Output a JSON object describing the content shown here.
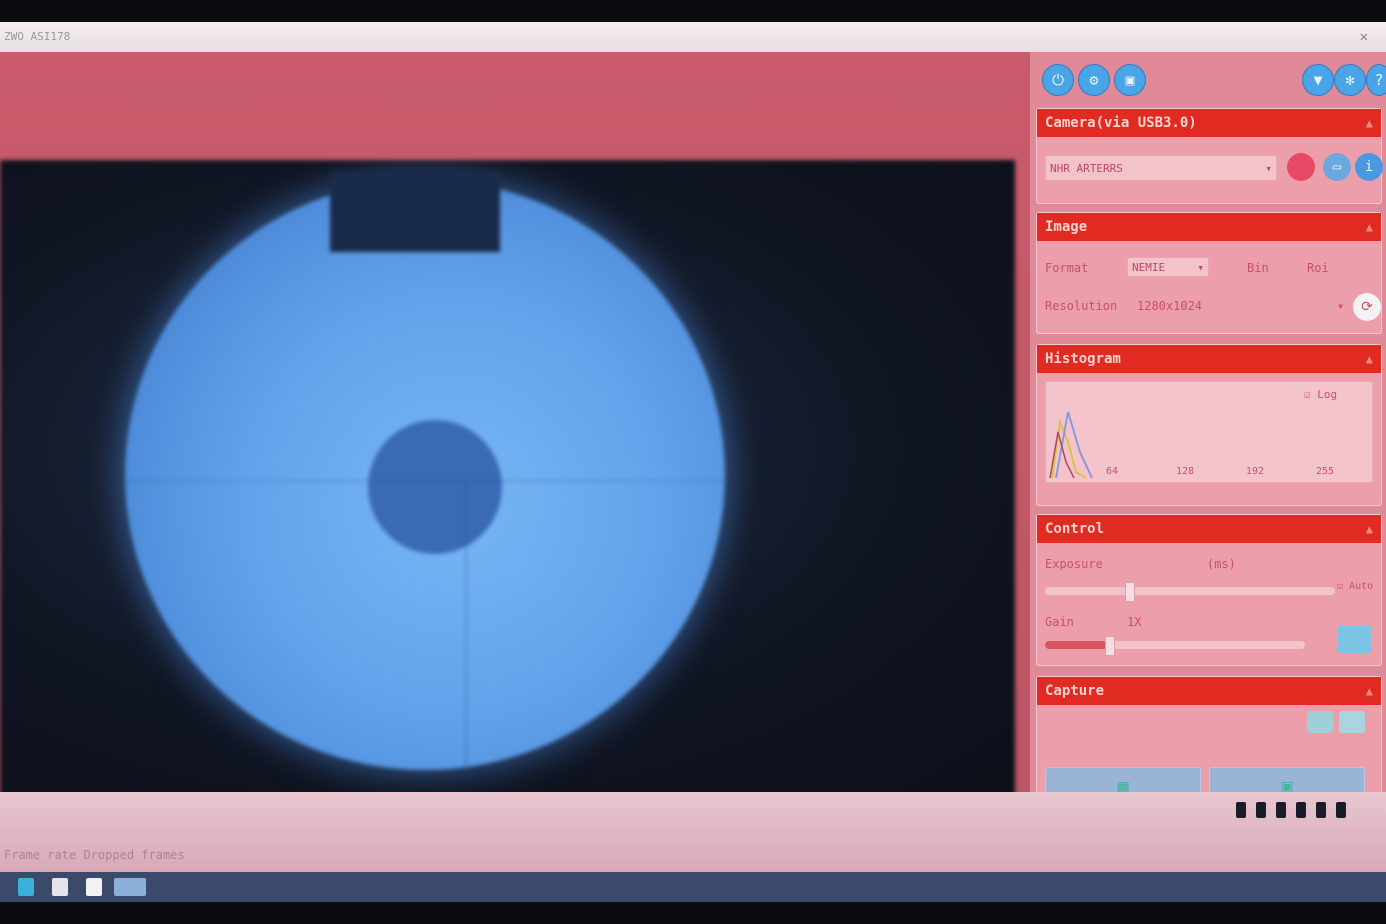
{
  "colors": {
    "section_header": "#e02a22",
    "panel_bg": "#e08a98",
    "beam": "#62a2ea",
    "toolbar_icon": "#4aa4e8"
  },
  "toolbar": {
    "left_icons": [
      "usb-icon",
      "settings-circle-icon",
      "save-icon"
    ],
    "right_icons": [
      "shirt-icon",
      "gear-icon",
      "help-icon"
    ]
  },
  "camera": {
    "header": "Camera(via USB3.0)",
    "device_value": "NHR ARTERRS",
    "icons": [
      "record-icon",
      "snapshot-icon",
      "info-icon"
    ]
  },
  "image": {
    "header": "Image",
    "format_label": "Format",
    "format_value": "NEMIE",
    "bin_label": "Bin",
    "roi_label": "Roi",
    "resolution_label": "Resolution",
    "resolution_value": "1280x1024"
  },
  "histogram": {
    "header": "Histogram",
    "log_label": "Log",
    "ticks": [
      "64",
      "128",
      "192",
      "255"
    ]
  },
  "control": {
    "header": "Control",
    "exposure_label": "Exposure",
    "exposure_unit": "(ms)",
    "auto_label": "Auto",
    "gain_label": "Gain",
    "gain_value": "1X"
  },
  "capture": {
    "header": "Capture"
  },
  "status": {
    "title_text": "ZWO ASI178",
    "bottom_text": "Frame rate  Dropped frames"
  }
}
